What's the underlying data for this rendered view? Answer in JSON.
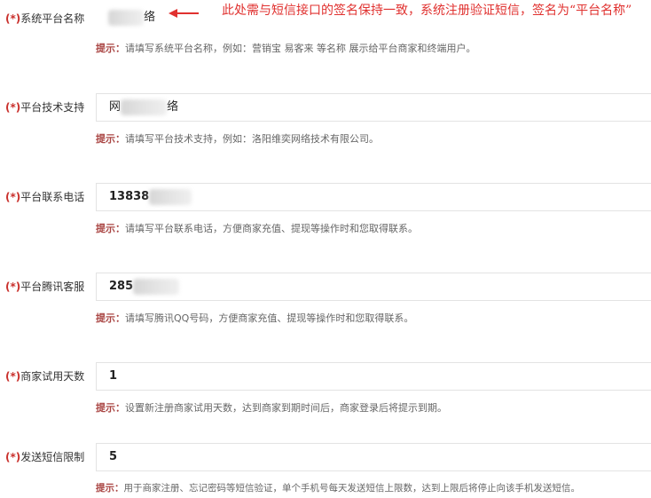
{
  "required_marker": "(*)",
  "hint_prefix": "提示：",
  "annotation": "此处需与短信接口的签名保持一致，系统注册验证短信，签名为“平台名称”",
  "fields": [
    {
      "label": "系统平台名称",
      "value_visible": "络",
      "hint": "请填写系统平台名称，例如：营销宝 易客来 等名称 展示给平台商家和终端用户。"
    },
    {
      "label": "平台技术支持",
      "value_visible": "网",
      "value_visible_end": "络",
      "hint": "请填写平台技术支持，例如：洛阳维奕网络技术有限公司。"
    },
    {
      "label": "平台联系电话",
      "value_visible": "13838",
      "hint": "请填写平台联系电话，方便商家充值、提现等操作时和您取得联系。"
    },
    {
      "label": "平台腾讯客服",
      "value_visible": "285",
      "hint": "请填写腾讯QQ号码，方便商家充值、提现等操作时和您取得联系。"
    },
    {
      "label": "商家试用天数",
      "value_visible": "1",
      "hint": "设置新注册商家试用天数，达到商家到期时间后，商家登录后将提示到期。"
    },
    {
      "label": "发送短信限制",
      "value_visible": "5",
      "hint": "用于商家注册、忘记密码等短信验证，单个手机号每天发送短信上限数，达到上限后将停止向该手机发送短信。"
    }
  ],
  "colors": {
    "required": "#c9302c",
    "hint_prefix": "#a94442",
    "annotation": "#e0312f",
    "border": "#e3e3e3"
  },
  "icons": [
    "red-arrow-icon"
  ]
}
